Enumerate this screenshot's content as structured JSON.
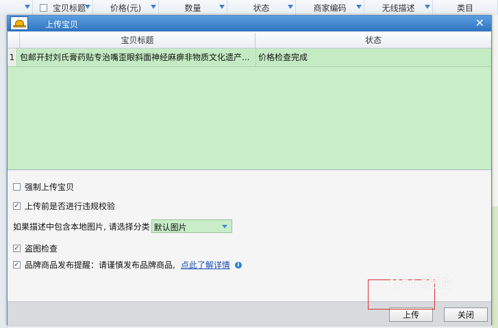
{
  "background": {
    "columns": [
      "宝贝标题",
      "价格(元)",
      "数量",
      "状态",
      "商家编码",
      "无线描述",
      "类目"
    ]
  },
  "dialog": {
    "title": "上传宝贝",
    "grid": {
      "headers": [
        "宝贝标题",
        "状态"
      ],
      "rows": [
        {
          "index": "1",
          "title": "包邮开封刘氏膏药贴专治嘴歪眼斜面神经麻痹非物质文化遗产...",
          "status": "价格检查完成"
        }
      ]
    },
    "options": {
      "force_upload": {
        "label": "强制上传宝贝",
        "checked": false
      },
      "violation_check": {
        "label": "上传前是否进行违规校验",
        "checked": true
      },
      "image_category": {
        "label": "如果描述中包含本地图片, 请选择分类",
        "selected": "默认图片"
      },
      "theft_check": {
        "label": "盗图检查",
        "checked": true
      },
      "brand_reminder": {
        "label": "品牌商品发布提醒：请谨慎发布品牌商品,",
        "link": "点此了解详情",
        "checked": true
      }
    },
    "buttons": {
      "upload": "上传",
      "close": "关闭"
    }
  },
  "watermark": "Bai 经验",
  "colors": {
    "titlebar": "#3f86d0",
    "grid_green": "#c8edc8",
    "highlight_red": "#d43030",
    "link_blue": "#1a4fb8"
  }
}
